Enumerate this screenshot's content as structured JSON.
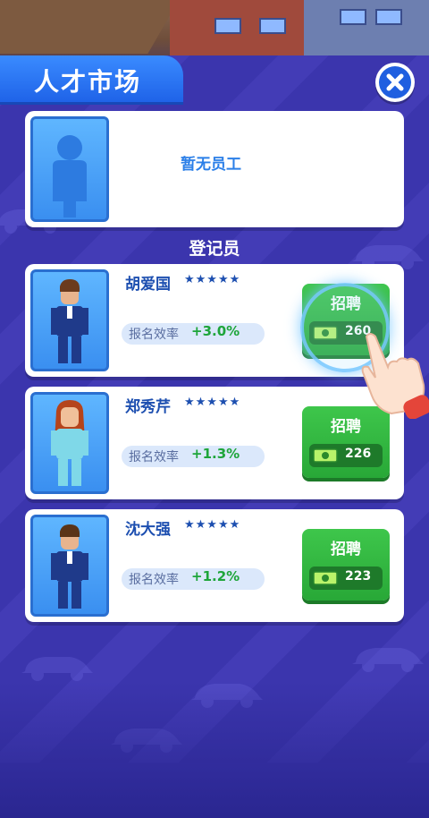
{
  "window": {
    "title": "人才市场"
  },
  "icons": {
    "close": "close-x-icon",
    "avatar_placeholder": "person-silhouette-icon",
    "cash": "cash-icon",
    "hand": "tutorial-hand-icon"
  },
  "empty_slot": {
    "label": "暂无员工"
  },
  "section": {
    "label": "登记员"
  },
  "candidates": [
    {
      "name": "胡爱国",
      "stars": "★★★★★",
      "efficiency_label": "报名效率",
      "efficiency_value": "+3.0%",
      "hire_label": "招聘",
      "cost": "260",
      "highlighted": true
    },
    {
      "name": "郑秀芹",
      "stars": "★★★★★",
      "efficiency_label": "报名效率",
      "efficiency_value": "+1.3%",
      "hire_label": "招聘",
      "cost": "226",
      "highlighted": false
    },
    {
      "name": "沈大强",
      "stars": "★★★★★",
      "efficiency_label": "报名效率",
      "efficiency_value": "+1.2%",
      "hire_label": "招聘",
      "cost": "223",
      "highlighted": false
    }
  ],
  "colors": {
    "accent": "#1f63e8",
    "hire": "#28a837",
    "background": "#3b35ad"
  }
}
